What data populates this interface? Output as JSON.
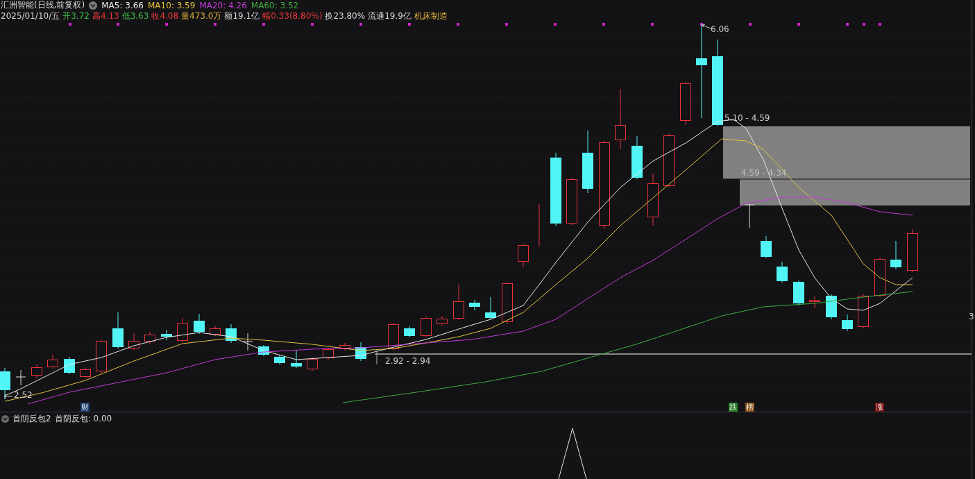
{
  "header": {
    "title": "汇洲智能(日线,前复权)",
    "ma_legend": [
      {
        "label": "MA5: 3.66",
        "color": "#e8e8e8"
      },
      {
        "label": "MA10: 3.59",
        "color": "#e2c33c"
      },
      {
        "label": "MA20: 4.26",
        "color": "#c43bd6"
      },
      {
        "label": "MA60: 3.52",
        "color": "#3fae3f"
      }
    ]
  },
  "quote": [
    {
      "text": "2025/01/10/五",
      "color": "#d8d8d8"
    },
    {
      "text": "开3.72",
      "color": "#3fc24a"
    },
    {
      "text": "高4.13",
      "color": "#f03a3a"
    },
    {
      "text": "低3.63",
      "color": "#3fc24a"
    },
    {
      "text": "收4.08",
      "color": "#f03a3a"
    },
    {
      "text": "量473.0万",
      "color": "#e2b43c"
    },
    {
      "text": "额19.1亿",
      "color": "#d8d8d8"
    },
    {
      "text": "幅0.33(8.80%)",
      "color": "#f03a3a"
    },
    {
      "text": "换23.80%",
      "color": "#d8d8d8"
    },
    {
      "text": "流通19.9亿",
      "color": "#d8d8d8"
    },
    {
      "text": "机床制造",
      "color": "#e2b43c"
    }
  ],
  "chart": {
    "high_label": "6.06",
    "low_label": "2.52",
    "zones": [
      "5.10 - 4.59",
      "4.59 - 4.34"
    ],
    "support_label": "2.92 - 2.94",
    "axis_label": "3"
  },
  "markers": [
    {
      "text": "财",
      "color": "#1e3f6e"
    },
    {
      "text": "跌",
      "color": "#1f7a1f"
    },
    {
      "text": "榜",
      "color": "#8a4f10"
    },
    {
      "text": "涨",
      "color": "#7a0d0d"
    }
  ],
  "indicator": {
    "name": "首阴反包2",
    "reading": "首阴反包: 0.00"
  }
}
